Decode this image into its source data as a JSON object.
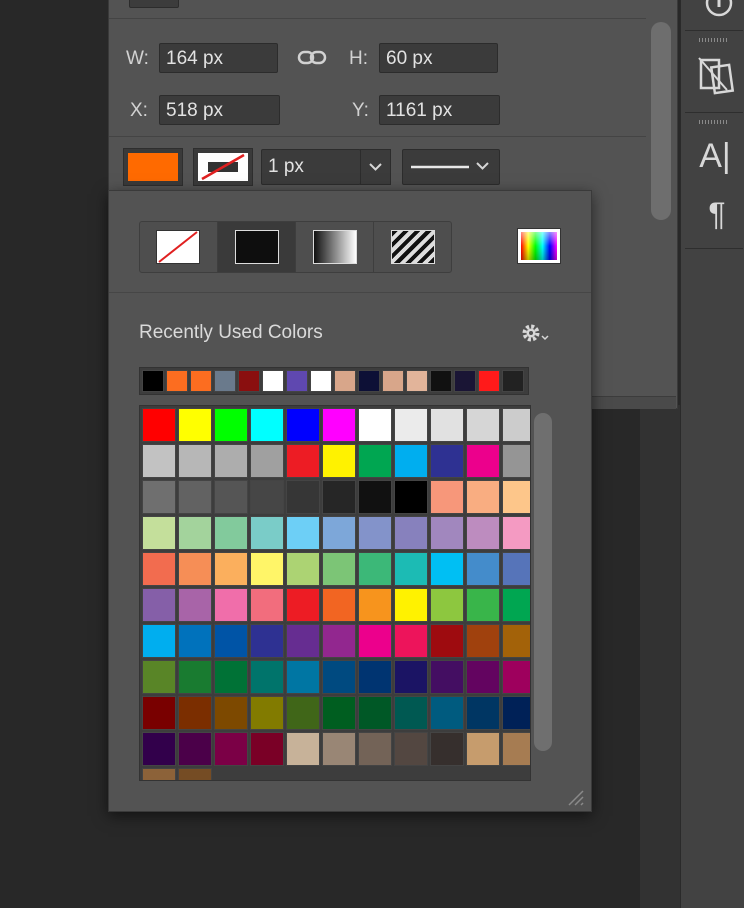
{
  "transform": {
    "w_label": "W:",
    "w_value": "164 px",
    "h_label": "H:",
    "h_value": "60 px",
    "x_label": "X:",
    "x_value": "518 px",
    "y_label": "Y:",
    "y_value": "1161 px",
    "link_icon": "link-icon"
  },
  "appearance": {
    "fill_color": "#ff6a00",
    "stroke_width": "1 px",
    "stroke_style": "solid-line",
    "dropdown_icon": "chevron-down-icon"
  },
  "popup": {
    "fill_types": [
      "none-swatch-icon",
      "solid-color-icon",
      "gradient-icon",
      "pattern-icon"
    ],
    "color_picker_icon": "color-picker-icon",
    "recent_label": "Recently Used Colors",
    "settings_icon": "gear-icon",
    "recent_colors": [
      "#000000",
      "#fc6d20",
      "#fc6d20",
      "#6a7a8c",
      "#8a0f0f",
      "#ffffff",
      "#5f48b0",
      "#ffffff",
      "#d8a68a",
      "#0d1036",
      "#d8a68a",
      "#e2b49a",
      "#111111",
      "#1a1535",
      "#ff1a1a",
      "#222222"
    ],
    "swatches": [
      [
        "#ff0000",
        "#ffff00",
        "#00ff00",
        "#00ffff",
        "#0000ff",
        "#ff00ff",
        "#ffffff",
        "#ebebeb",
        "#e1e1e1",
        "#d6d6d6",
        "#cccccc"
      ],
      [
        "#c2c2c2",
        "#b7b7b7",
        "#adadad",
        "#a0a0a0",
        "#ed1c24",
        "#fff200",
        "#00a651",
        "#00aeef",
        "#2e3192",
        "#ec008c",
        "#959595"
      ],
      [
        "#6f6f6f",
        "#626262",
        "#555555",
        "#464646",
        "#363636",
        "#262626",
        "#111111",
        "#000000",
        "#f7977a",
        "#f9ad81",
        "#fdc68a"
      ],
      [
        "#c4df9b",
        "#a3d39c",
        "#82ca9c",
        "#7accc8",
        "#6dcff6",
        "#7da7d9",
        "#8393ca",
        "#8781bd",
        "#a187be",
        "#bd8cbf",
        "#f49ac2"
      ],
      [
        "#f26c4f",
        "#f68e56",
        "#fbaf5d",
        "#fff568",
        "#acd373",
        "#7cc576",
        "#3cb878",
        "#1cbbb4",
        "#00bff3",
        "#448ccb",
        "#5674b9"
      ],
      [
        "#855fa8",
        "#a864a8",
        "#f06eaa",
        "#f26d7d",
        "#ed1c24",
        "#f26522",
        "#f7941d",
        "#fff200",
        "#8dc73f",
        "#39b54a",
        "#00a651"
      ],
      [
        "#00aeef",
        "#0072bc",
        "#0054a6",
        "#2e3192",
        "#662d91",
        "#92278f",
        "#ec008c",
        "#ed145b",
        "#9e0b0f",
        "#a0410d",
        "#a36209"
      ],
      [
        "#598527",
        "#197b30",
        "#007236",
        "#00746b",
        "#0076a3",
        "#004a80",
        "#003471",
        "#1b1464",
        "#440e62",
        "#630460",
        "#9e005d"
      ],
      [
        "#790000",
        "#7b2e00",
        "#7d4900",
        "#827b00",
        "#406618",
        "#005e20",
        "#005826",
        "#005952",
        "#005b7f",
        "#003663",
        "#002157"
      ],
      [
        "#32004b",
        "#4b0049",
        "#7b0046",
        "#7a0026",
        "#c7b299",
        "#998675",
        "#736357",
        "#534741",
        "#362f2d",
        "#c69c6d",
        "#a67c52"
      ],
      [
        "#8c6239",
        "#754c24"
      ]
    ]
  }
}
